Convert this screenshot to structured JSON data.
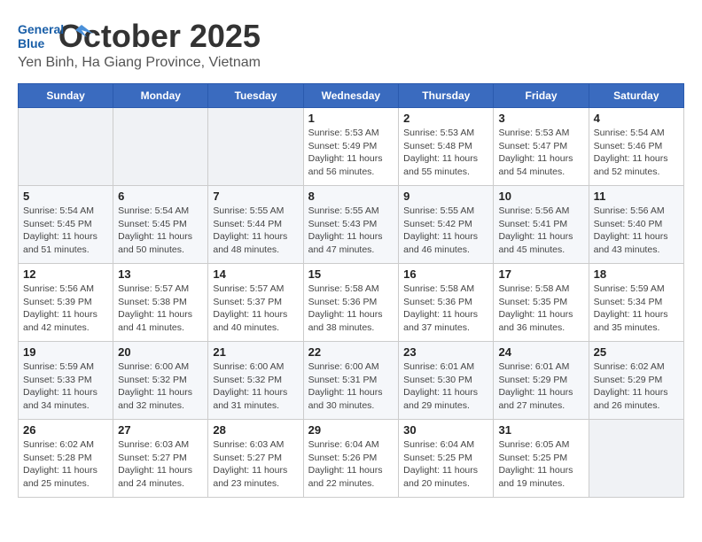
{
  "logo": {
    "line1": "General",
    "line2": "Blue"
  },
  "header": {
    "month_year": "October 2025",
    "location": "Yen Binh, Ha Giang Province, Vietnam"
  },
  "weekdays": [
    "Sunday",
    "Monday",
    "Tuesday",
    "Wednesday",
    "Thursday",
    "Friday",
    "Saturday"
  ],
  "weeks": [
    [
      {
        "day": "",
        "sunrise": "",
        "sunset": "",
        "daylight": ""
      },
      {
        "day": "",
        "sunrise": "",
        "sunset": "",
        "daylight": ""
      },
      {
        "day": "",
        "sunrise": "",
        "sunset": "",
        "daylight": ""
      },
      {
        "day": "1",
        "sunrise": "Sunrise: 5:53 AM",
        "sunset": "Sunset: 5:49 PM",
        "daylight": "Daylight: 11 hours and 56 minutes."
      },
      {
        "day": "2",
        "sunrise": "Sunrise: 5:53 AM",
        "sunset": "Sunset: 5:48 PM",
        "daylight": "Daylight: 11 hours and 55 minutes."
      },
      {
        "day": "3",
        "sunrise": "Sunrise: 5:53 AM",
        "sunset": "Sunset: 5:47 PM",
        "daylight": "Daylight: 11 hours and 54 minutes."
      },
      {
        "day": "4",
        "sunrise": "Sunrise: 5:54 AM",
        "sunset": "Sunset: 5:46 PM",
        "daylight": "Daylight: 11 hours and 52 minutes."
      }
    ],
    [
      {
        "day": "5",
        "sunrise": "Sunrise: 5:54 AM",
        "sunset": "Sunset: 5:45 PM",
        "daylight": "Daylight: 11 hours and 51 minutes."
      },
      {
        "day": "6",
        "sunrise": "Sunrise: 5:54 AM",
        "sunset": "Sunset: 5:45 PM",
        "daylight": "Daylight: 11 hours and 50 minutes."
      },
      {
        "day": "7",
        "sunrise": "Sunrise: 5:55 AM",
        "sunset": "Sunset: 5:44 PM",
        "daylight": "Daylight: 11 hours and 48 minutes."
      },
      {
        "day": "8",
        "sunrise": "Sunrise: 5:55 AM",
        "sunset": "Sunset: 5:43 PM",
        "daylight": "Daylight: 11 hours and 47 minutes."
      },
      {
        "day": "9",
        "sunrise": "Sunrise: 5:55 AM",
        "sunset": "Sunset: 5:42 PM",
        "daylight": "Daylight: 11 hours and 46 minutes."
      },
      {
        "day": "10",
        "sunrise": "Sunrise: 5:56 AM",
        "sunset": "Sunset: 5:41 PM",
        "daylight": "Daylight: 11 hours and 45 minutes."
      },
      {
        "day": "11",
        "sunrise": "Sunrise: 5:56 AM",
        "sunset": "Sunset: 5:40 PM",
        "daylight": "Daylight: 11 hours and 43 minutes."
      }
    ],
    [
      {
        "day": "12",
        "sunrise": "Sunrise: 5:56 AM",
        "sunset": "Sunset: 5:39 PM",
        "daylight": "Daylight: 11 hours and 42 minutes."
      },
      {
        "day": "13",
        "sunrise": "Sunrise: 5:57 AM",
        "sunset": "Sunset: 5:38 PM",
        "daylight": "Daylight: 11 hours and 41 minutes."
      },
      {
        "day": "14",
        "sunrise": "Sunrise: 5:57 AM",
        "sunset": "Sunset: 5:37 PM",
        "daylight": "Daylight: 11 hours and 40 minutes."
      },
      {
        "day": "15",
        "sunrise": "Sunrise: 5:58 AM",
        "sunset": "Sunset: 5:36 PM",
        "daylight": "Daylight: 11 hours and 38 minutes."
      },
      {
        "day": "16",
        "sunrise": "Sunrise: 5:58 AM",
        "sunset": "Sunset: 5:36 PM",
        "daylight": "Daylight: 11 hours and 37 minutes."
      },
      {
        "day": "17",
        "sunrise": "Sunrise: 5:58 AM",
        "sunset": "Sunset: 5:35 PM",
        "daylight": "Daylight: 11 hours and 36 minutes."
      },
      {
        "day": "18",
        "sunrise": "Sunrise: 5:59 AM",
        "sunset": "Sunset: 5:34 PM",
        "daylight": "Daylight: 11 hours and 35 minutes."
      }
    ],
    [
      {
        "day": "19",
        "sunrise": "Sunrise: 5:59 AM",
        "sunset": "Sunset: 5:33 PM",
        "daylight": "Daylight: 11 hours and 34 minutes."
      },
      {
        "day": "20",
        "sunrise": "Sunrise: 6:00 AM",
        "sunset": "Sunset: 5:32 PM",
        "daylight": "Daylight: 11 hours and 32 minutes."
      },
      {
        "day": "21",
        "sunrise": "Sunrise: 6:00 AM",
        "sunset": "Sunset: 5:32 PM",
        "daylight": "Daylight: 11 hours and 31 minutes."
      },
      {
        "day": "22",
        "sunrise": "Sunrise: 6:00 AM",
        "sunset": "Sunset: 5:31 PM",
        "daylight": "Daylight: 11 hours and 30 minutes."
      },
      {
        "day": "23",
        "sunrise": "Sunrise: 6:01 AM",
        "sunset": "Sunset: 5:30 PM",
        "daylight": "Daylight: 11 hours and 29 minutes."
      },
      {
        "day": "24",
        "sunrise": "Sunrise: 6:01 AM",
        "sunset": "Sunset: 5:29 PM",
        "daylight": "Daylight: 11 hours and 27 minutes."
      },
      {
        "day": "25",
        "sunrise": "Sunrise: 6:02 AM",
        "sunset": "Sunset: 5:29 PM",
        "daylight": "Daylight: 11 hours and 26 minutes."
      }
    ],
    [
      {
        "day": "26",
        "sunrise": "Sunrise: 6:02 AM",
        "sunset": "Sunset: 5:28 PM",
        "daylight": "Daylight: 11 hours and 25 minutes."
      },
      {
        "day": "27",
        "sunrise": "Sunrise: 6:03 AM",
        "sunset": "Sunset: 5:27 PM",
        "daylight": "Daylight: 11 hours and 24 minutes."
      },
      {
        "day": "28",
        "sunrise": "Sunrise: 6:03 AM",
        "sunset": "Sunset: 5:27 PM",
        "daylight": "Daylight: 11 hours and 23 minutes."
      },
      {
        "day": "29",
        "sunrise": "Sunrise: 6:04 AM",
        "sunset": "Sunset: 5:26 PM",
        "daylight": "Daylight: 11 hours and 22 minutes."
      },
      {
        "day": "30",
        "sunrise": "Sunrise: 6:04 AM",
        "sunset": "Sunset: 5:25 PM",
        "daylight": "Daylight: 11 hours and 20 minutes."
      },
      {
        "day": "31",
        "sunrise": "Sunrise: 6:05 AM",
        "sunset": "Sunset: 5:25 PM",
        "daylight": "Daylight: 11 hours and 19 minutes."
      },
      {
        "day": "",
        "sunrise": "",
        "sunset": "",
        "daylight": ""
      }
    ]
  ]
}
